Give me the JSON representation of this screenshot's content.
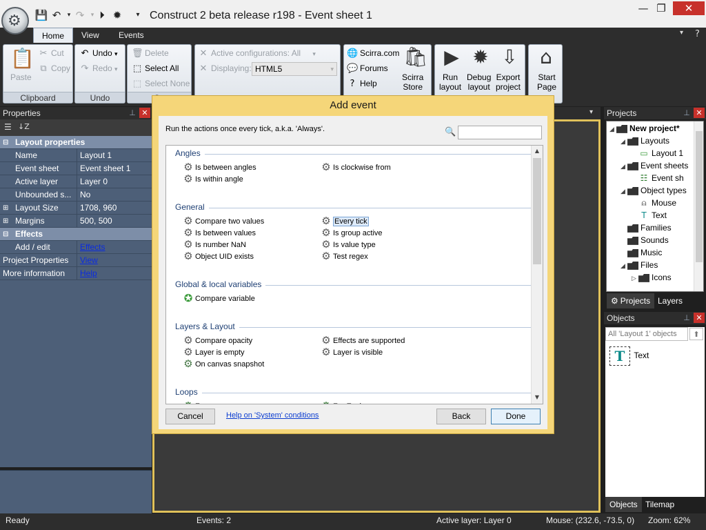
{
  "window": {
    "title": "Construct 2 beta release r198 - Event sheet 1",
    "minimize_glyph": "—",
    "maximize_glyph": "❐",
    "close_glyph": "✕"
  },
  "qat": {
    "save_icon": "save-icon",
    "undo_icon": "undo-icon",
    "redo_icon": "redo-icon",
    "run_icon": "run-icon",
    "debug_icon": "debug-icon",
    "customize_glyph": "▾"
  },
  "ribbon": {
    "tabs": [
      "Home",
      "View",
      "Events"
    ],
    "clipboard": {
      "paste": "Paste",
      "cut": "Cut",
      "copy": "Copy",
      "group": "Clipboard"
    },
    "undo": {
      "undo": "Undo",
      "redo": "Redo",
      "group": "Undo"
    },
    "select": {
      "delete": "Delete",
      "select_all": "Select All",
      "select_none": "Select None",
      "group": "Se"
    },
    "config": {
      "active_configurations": "Active configurations: All",
      "displaying": "Displaying:",
      "displaying_value": "HTML5"
    },
    "links": {
      "scirra": "Scirra.com",
      "forums": "Forums",
      "help": "Help",
      "store_line1": "Scirra",
      "store_line2": "Store"
    },
    "run": {
      "run_line1": "Run",
      "run_line2": "layout",
      "debug_line1": "Debug",
      "debug_line2": "layout",
      "export_line1": "Export",
      "export_line2": "project"
    },
    "start": {
      "line1": "Start",
      "line2": "Page"
    }
  },
  "properties": {
    "title": "Properties",
    "rows": [
      {
        "type": "cat",
        "label": "Layout properties",
        "exp": "⊟"
      },
      {
        "name": "Name",
        "value": "Layout 1"
      },
      {
        "name": "Event sheet",
        "value": "Event sheet 1"
      },
      {
        "name": "Active layer",
        "value": "Layer 0"
      },
      {
        "name": "Unbounded s...",
        "value": "No"
      },
      {
        "name": "Layout Size",
        "value": "1708, 960",
        "exp": "⊞"
      },
      {
        "name": "Margins",
        "value": "500, 500",
        "exp": "⊞"
      },
      {
        "type": "cat",
        "label": "Effects",
        "exp": "⊟"
      },
      {
        "name": "Add / edit",
        "link": "Effects"
      },
      {
        "full": "Project Properties",
        "link": "View"
      },
      {
        "full": "More information",
        "link": "Help"
      }
    ]
  },
  "projects": {
    "title": "Projects",
    "tree": [
      {
        "label": "New project*",
        "indent": 0,
        "tw": "◢",
        "kind": "folder",
        "bold": true
      },
      {
        "label": "Layouts",
        "indent": 1,
        "tw": "◢",
        "kind": "folder"
      },
      {
        "label": "Layout 1",
        "indent": 2,
        "tw": "",
        "kind": "layout"
      },
      {
        "label": "Event sheets",
        "indent": 1,
        "tw": "◢",
        "kind": "folder"
      },
      {
        "label": "Event sh",
        "indent": 2,
        "tw": "",
        "kind": "sheet"
      },
      {
        "label": "Object types",
        "indent": 1,
        "tw": "◢",
        "kind": "folder"
      },
      {
        "label": "Mouse",
        "indent": 2,
        "tw": "",
        "kind": "mouse"
      },
      {
        "label": "Text",
        "indent": 2,
        "tw": "",
        "kind": "text"
      },
      {
        "label": "Families",
        "indent": 1,
        "tw": "",
        "kind": "folder"
      },
      {
        "label": "Sounds",
        "indent": 1,
        "tw": "",
        "kind": "folder"
      },
      {
        "label": "Music",
        "indent": 1,
        "tw": "",
        "kind": "folder"
      },
      {
        "label": "Files",
        "indent": 1,
        "tw": "◢",
        "kind": "folder"
      },
      {
        "label": "Icons",
        "indent": 2,
        "tw": "▷",
        "kind": "folder"
      }
    ],
    "tabs": [
      "Projects",
      "Layers"
    ]
  },
  "objects": {
    "title": "Objects",
    "filter_placeholder": "All 'Layout 1' objects",
    "items": [
      {
        "label": "Text",
        "icon": "T"
      }
    ],
    "tabs": [
      "Objects",
      "Tilemap"
    ]
  },
  "status": {
    "ready": "Ready",
    "events": "Events: 2",
    "active_layer": "Active layer: Layer 0",
    "mouse": "Mouse: (232.6, -73.5, 0)",
    "zoom": "Zoom: 62%"
  },
  "dialog": {
    "title": "Add event",
    "description": "Run the actions once every tick, a.k.a. 'Always'.",
    "sections": [
      {
        "name": "Angles",
        "items": [
          {
            "label": "Is between angles",
            "col": 0,
            "row": 0
          },
          {
            "label": "Is clockwise from",
            "col": 1,
            "row": 0
          },
          {
            "label": "Is within angle",
            "col": 0,
            "row": 1
          }
        ]
      },
      {
        "name": "General",
        "items": [
          {
            "label": "Compare two values",
            "col": 0,
            "row": 0
          },
          {
            "label": "Every tick",
            "col": 1,
            "row": 0,
            "selected": true
          },
          {
            "label": "Is between values",
            "col": 0,
            "row": 1
          },
          {
            "label": "Is group active",
            "col": 1,
            "row": 1
          },
          {
            "label": "Is number NaN",
            "col": 0,
            "row": 2
          },
          {
            "label": "Is value type",
            "col": 1,
            "row": 2
          },
          {
            "label": "Object UID exists",
            "col": 0,
            "row": 3
          },
          {
            "label": "Test regex",
            "col": 1,
            "row": 3
          }
        ]
      },
      {
        "name": "Global & local variables",
        "items": [
          {
            "label": "Compare variable",
            "col": 0,
            "row": 0,
            "icon": "globe"
          }
        ]
      },
      {
        "name": "Layers & Layout",
        "items": [
          {
            "label": "Compare opacity",
            "col": 0,
            "row": 0
          },
          {
            "label": "Effects are supported",
            "col": 1,
            "row": 0
          },
          {
            "label": "Layer is empty",
            "col": 0,
            "row": 1
          },
          {
            "label": "Layer is visible",
            "col": 1,
            "row": 1
          },
          {
            "label": "On canvas snapshot",
            "col": 0,
            "row": 2,
            "icon": "trigger"
          }
        ]
      },
      {
        "name": "Loops",
        "items": [
          {
            "label": "For",
            "col": 0,
            "row": 0,
            "icon": "loop"
          },
          {
            "label": "For Each",
            "col": 1,
            "row": 0,
            "icon": "loop"
          }
        ]
      }
    ],
    "buttons": {
      "cancel": "Cancel",
      "help": "Help on 'System' conditions",
      "back": "Back",
      "done": "Done"
    }
  },
  "colors": {
    "accent": "#f5d679",
    "panel_blue": "#4d5f78",
    "category": "#7d8ea8",
    "dark": "#2d2d2d"
  }
}
